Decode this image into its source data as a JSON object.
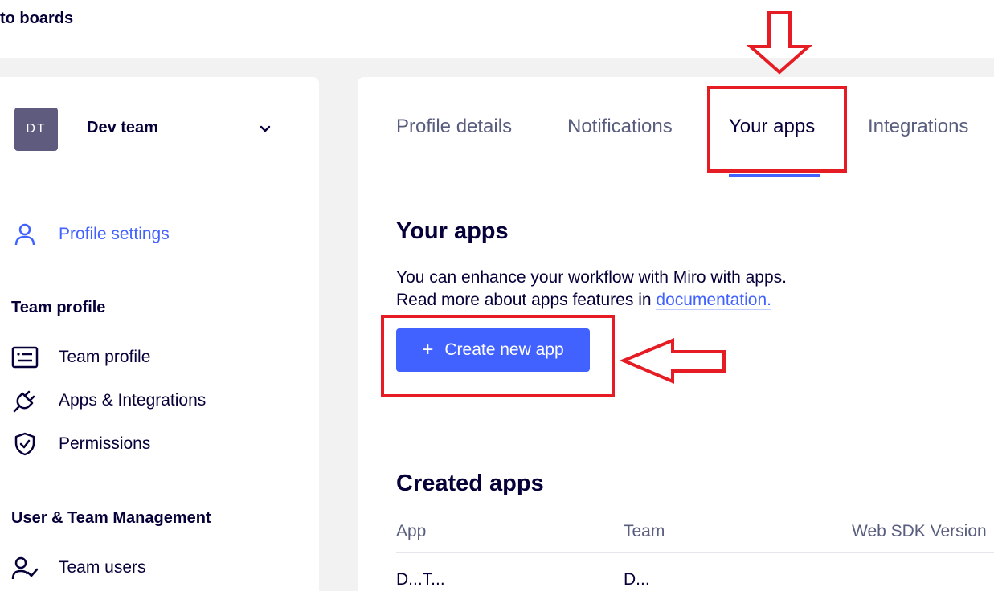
{
  "header": {
    "back_label": "to boards"
  },
  "sidebar": {
    "team": {
      "avatar_initials": "DT",
      "name": "Dev team"
    },
    "profile_settings": {
      "label": "Profile settings",
      "icon": "user-icon"
    },
    "team_profile_section": {
      "title": "Team profile",
      "items": [
        {
          "label": "Team profile",
          "icon": "list-card-icon"
        },
        {
          "label": "Apps & Integrations",
          "icon": "plug-icon"
        },
        {
          "label": "Permissions",
          "icon": "shield-check-icon"
        }
      ]
    },
    "management_section": {
      "title": "User & Team Management",
      "items": [
        {
          "label": "Team users",
          "icon": "users-check-icon"
        }
      ]
    }
  },
  "tabs": [
    {
      "label": "Profile details",
      "active": false
    },
    {
      "label": "Notifications",
      "active": false
    },
    {
      "label": "Your apps",
      "active": true
    },
    {
      "label": "Integrations",
      "active": false
    }
  ],
  "your_apps": {
    "title": "Your apps",
    "line1": "You can enhance your workflow with Miro with apps.",
    "line2_prefix": "Read more about apps features in",
    "doc_link": "documentation.",
    "create_button": "Create new app"
  },
  "created_apps": {
    "title": "Created apps",
    "columns": [
      "App",
      "Team",
      "Web SDK Version"
    ],
    "rows": [
      {
        "app": "D...T...",
        "team": "D..."
      }
    ]
  },
  "colors": {
    "accent": "#4262ff",
    "text": "#050038",
    "muted": "#595e7e",
    "annotation": "#e51c23",
    "avatar": "#5f5b7e"
  }
}
